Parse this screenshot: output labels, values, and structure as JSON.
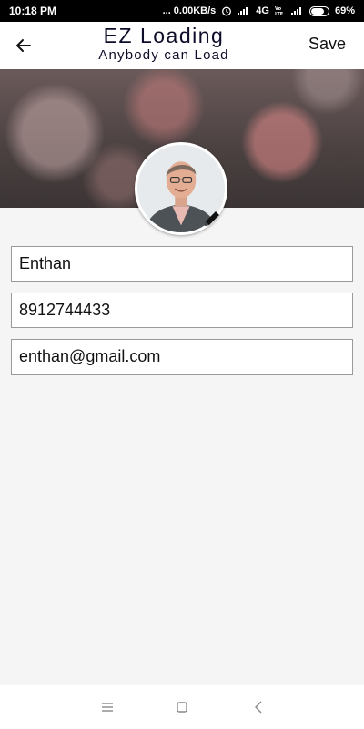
{
  "status_bar": {
    "time": "10:18 PM",
    "network_speed": "... 0.00KB/s",
    "network_type": "4G",
    "battery": "69%",
    "icons": [
      "alarm-icon",
      "signal-icon",
      "volte-icon",
      "battery-icon"
    ]
  },
  "app_bar": {
    "title": "EZ Loading",
    "subtitle": "Anybody can Load",
    "save_label": "Save",
    "back_icon": "back-arrow-icon"
  },
  "profile": {
    "avatar_icon": "profile-photo",
    "edit_icon": "pencil-icon"
  },
  "form": {
    "name": "Enthan",
    "phone": "8912744433",
    "email": "enthan@gmail.com"
  },
  "nav_bar": {
    "icons": [
      "menu-icon",
      "home-icon",
      "back-icon"
    ]
  }
}
